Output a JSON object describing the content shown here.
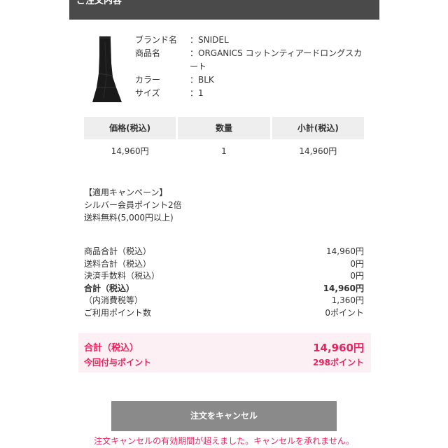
{
  "header": {
    "title": "ご注文内容"
  },
  "product": {
    "brand_label": "ブランド名",
    "brand_value": "：SNIDEL",
    "name_label": "商品名",
    "name_value": "：ORGANICS コットンティアードロングスカート",
    "color_label": "カラー",
    "color_value": "：BLK",
    "size_label": "サイズ",
    "size_value": "：1"
  },
  "price_table": {
    "headers": [
      "価格(税込)",
      "数量",
      "小計(税込)"
    ],
    "values": [
      "14,960円",
      "1",
      "14,960円"
    ]
  },
  "campaign": {
    "title": "【適用キャンペーン】",
    "line1": "シルバー会員ポイント2倍",
    "line2": "送料無料(5,000円以上)"
  },
  "totals": {
    "rows": [
      {
        "label": "商品合計（税込）",
        "value": "14,960円"
      },
      {
        "label": "送料合計（税込）",
        "value": "0円"
      },
      {
        "label": "決済手数料（税込）",
        "value": "0円"
      },
      {
        "label": "合計（税込）",
        "value": "14,960円"
      },
      {
        "label": "（内消費税等）",
        "value": "1,360円"
      },
      {
        "label": "ご利用ポイント数",
        "value": "0ポイント"
      }
    ]
  },
  "grand": {
    "total_label": "合計（税込）",
    "total_value": "14,960円",
    "points_label": "今回付与ポイント",
    "points_value": "298ポイント"
  },
  "actions": {
    "cancel_label": "注文をキャンセル"
  },
  "notice": {
    "text": "注文キャンセルの有効期間が超えました。キャンセルを承れません。"
  },
  "colors": {
    "accent": "#e8245f",
    "header_bg": "#4a4a4a",
    "button_bg": "#8a8a8a",
    "highlight_bg": "#fdf0f4"
  }
}
